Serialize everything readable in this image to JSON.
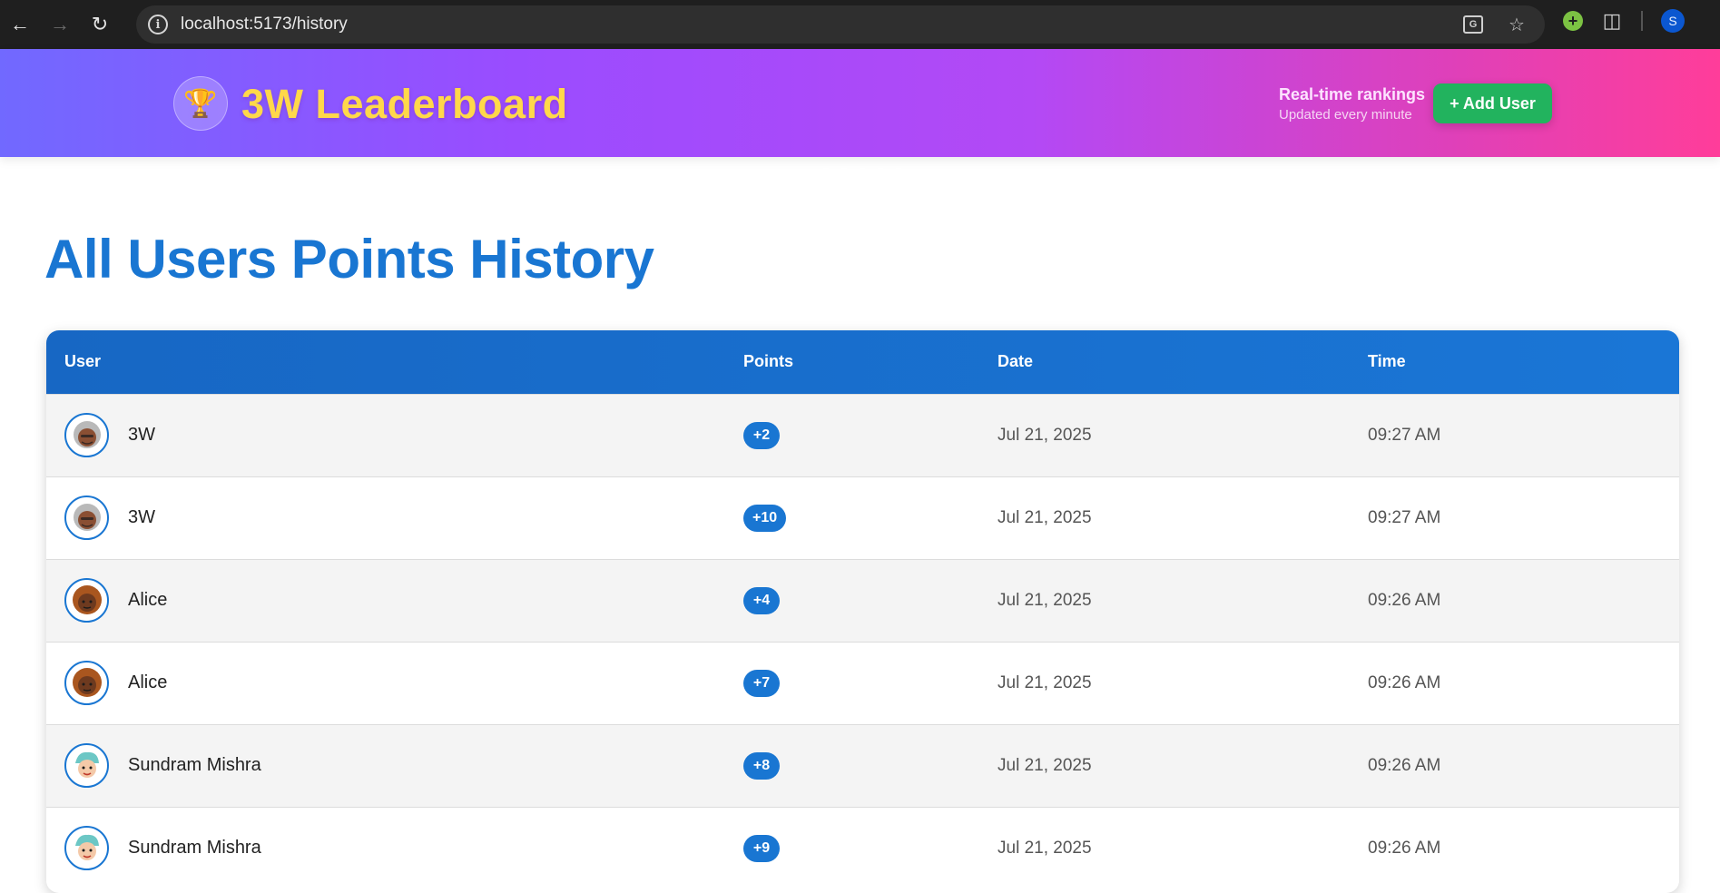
{
  "browser": {
    "url": "localhost:5173/history",
    "profile_initial": "S"
  },
  "header": {
    "logo_icon": "trophy-icon",
    "brand": "3W Leaderboard",
    "realtime_title": "Real-time rankings",
    "realtime_sub": "Updated every minute",
    "add_user_label": "+ Add User"
  },
  "page": {
    "title": "All Users Points History"
  },
  "table": {
    "headers": [
      "User",
      "Points",
      "Date",
      "Time"
    ],
    "rows": [
      {
        "user": "3W",
        "points": "+2",
        "date": "Jul 21, 2025",
        "time": "09:27 AM",
        "avatar": "grey"
      },
      {
        "user": "3W",
        "points": "+10",
        "date": "Jul 21, 2025",
        "time": "09:27 AM",
        "avatar": "grey"
      },
      {
        "user": "Alice",
        "points": "+4",
        "date": "Jul 21, 2025",
        "time": "09:26 AM",
        "avatar": "brown"
      },
      {
        "user": "Alice",
        "points": "+7",
        "date": "Jul 21, 2025",
        "time": "09:26 AM",
        "avatar": "brown"
      },
      {
        "user": "Sundram Mishra",
        "points": "+8",
        "date": "Jul 21, 2025",
        "time": "09:26 AM",
        "avatar": "teal"
      },
      {
        "user": "Sundram Mishra",
        "points": "+9",
        "date": "Jul 21, 2025",
        "time": "09:26 AM",
        "avatar": "teal"
      }
    ]
  },
  "colors": {
    "accent": "#1976d2",
    "button_green": "#22b35e",
    "brand_yellow": "#ffd84a"
  }
}
